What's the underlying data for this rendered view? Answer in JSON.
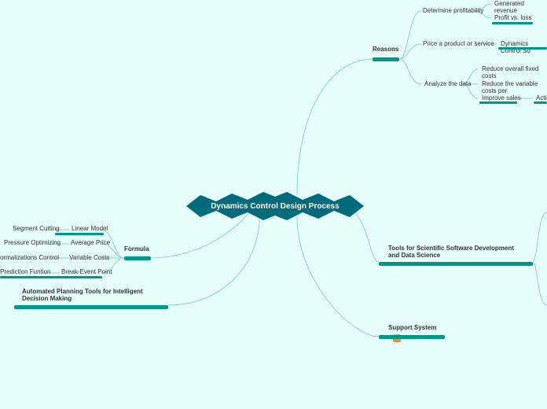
{
  "central": "Dynamics Control Design Process",
  "reasons": {
    "label": "Reasons",
    "determine_profitability": "Determine profitability",
    "generated_revenue": "Generated revenue",
    "profit_vs_loss": "Profit vs. loss",
    "price_product": "Price a product or service",
    "dynamics_control_so": "Dynamics Control So",
    "analyze_data": "Analyze the data",
    "reduce_fixed": "Reduce overall fixed costs",
    "reduce_variable": "Reduce the variable costs per",
    "improve_sales": "Improve sales",
    "actio": "Actio"
  },
  "tools_sci": "Tools for Scientific Software Development and Data Science",
  "support_system": "Support System",
  "formula": {
    "label": "Formula",
    "linear_model": "Linear Model",
    "segment_cutting": "Segment Cutting",
    "average_price": "Average Price",
    "pressure_optimizing": "Pressure Optimizing",
    "variable_costs": "Variable Costs",
    "normalizations_control": "ormalizations Control",
    "break_event_point": "Break-Event Point",
    "prediction_funtion": "Prediction Funtion"
  },
  "automated_planning": "Automated Planning Tools for Intelligent Decision Making",
  "colors": {
    "teal": "#009688",
    "darkteal": "#006b7a"
  }
}
